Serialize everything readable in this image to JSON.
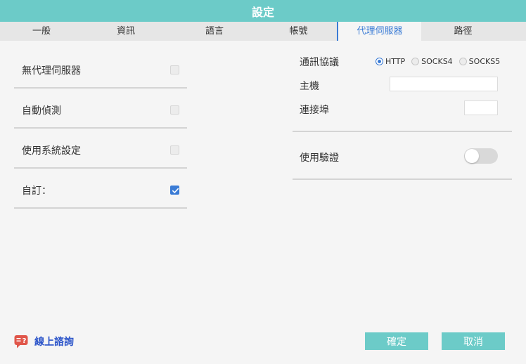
{
  "window": {
    "title": "設定"
  },
  "tabs": [
    {
      "label": "一般"
    },
    {
      "label": "資訊"
    },
    {
      "label": "語言"
    },
    {
      "label": "帳號"
    },
    {
      "label": "代理伺服器"
    },
    {
      "label": "路徑"
    }
  ],
  "active_tab": "代理伺服器",
  "proxy_modes": [
    {
      "label": "無代理伺服器",
      "checked": false
    },
    {
      "label": "自動偵測",
      "checked": false
    },
    {
      "label": "使用系統設定",
      "checked": false
    },
    {
      "label": "自訂：",
      "checked": true
    }
  ],
  "protocol": {
    "label": "通訊協議",
    "options": [
      {
        "label": "HTTP",
        "selected": true
      },
      {
        "label": "SOCKS4",
        "selected": false
      },
      {
        "label": "SOCKS5",
        "selected": false
      }
    ]
  },
  "host": {
    "label": "主機",
    "value": "",
    "placeholder": ""
  },
  "port": {
    "label": "連接埠",
    "value": "",
    "placeholder": ""
  },
  "auth": {
    "label": "使用驗證",
    "enabled": false
  },
  "footer": {
    "chat_label": "線上諮詢",
    "confirm_label": "確定",
    "cancel_label": "取消"
  },
  "colors": {
    "accent": "#6ccbc8",
    "selection": "#3a7bd5",
    "link": "#2b54c9",
    "chat_icon": "#e0564a"
  }
}
